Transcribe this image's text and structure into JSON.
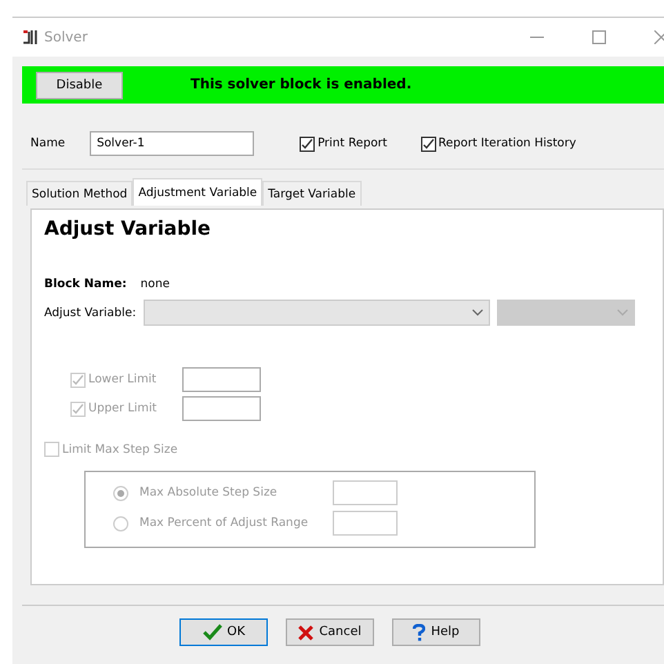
{
  "window": {
    "title": "Solver"
  },
  "status_bar": {
    "button": "Disable",
    "message": "This solver block is enabled.",
    "enabled": true
  },
  "name_field": {
    "label": "Name",
    "value": "Solver-1"
  },
  "options": [
    {
      "label": "Print Report",
      "checked": true
    },
    {
      "label": "Report Iteration History",
      "checked": true
    }
  ],
  "tabs": [
    {
      "label": "Solution Method",
      "selected": false
    },
    {
      "label": "Adjustment Variable",
      "selected": true
    },
    {
      "label": "Target Variable",
      "selected": false
    }
  ],
  "panel": {
    "heading": "Adjust Variable",
    "block_name_label": "Block Name:",
    "block_name_value": "none",
    "adjust_variable_label": "Adjust Variable:",
    "limits": [
      {
        "label": "Lower Limit",
        "checked": true,
        "disabled": true
      },
      {
        "label": "Upper Limit",
        "checked": true,
        "disabled": true
      }
    ],
    "limit_step": {
      "label": "Limit Max Step Size",
      "checked": false,
      "disabled": true
    },
    "step_options": [
      {
        "label": "Max Absolute Step Size",
        "selected": true,
        "disabled": true
      },
      {
        "label": "Max Percent of Adjust Range",
        "selected": false,
        "disabled": true
      }
    ]
  },
  "buttons": [
    {
      "label": "OK",
      "kind": "ok"
    },
    {
      "label": "Cancel",
      "kind": "cancel"
    },
    {
      "label": "Help",
      "kind": "help"
    }
  ]
}
